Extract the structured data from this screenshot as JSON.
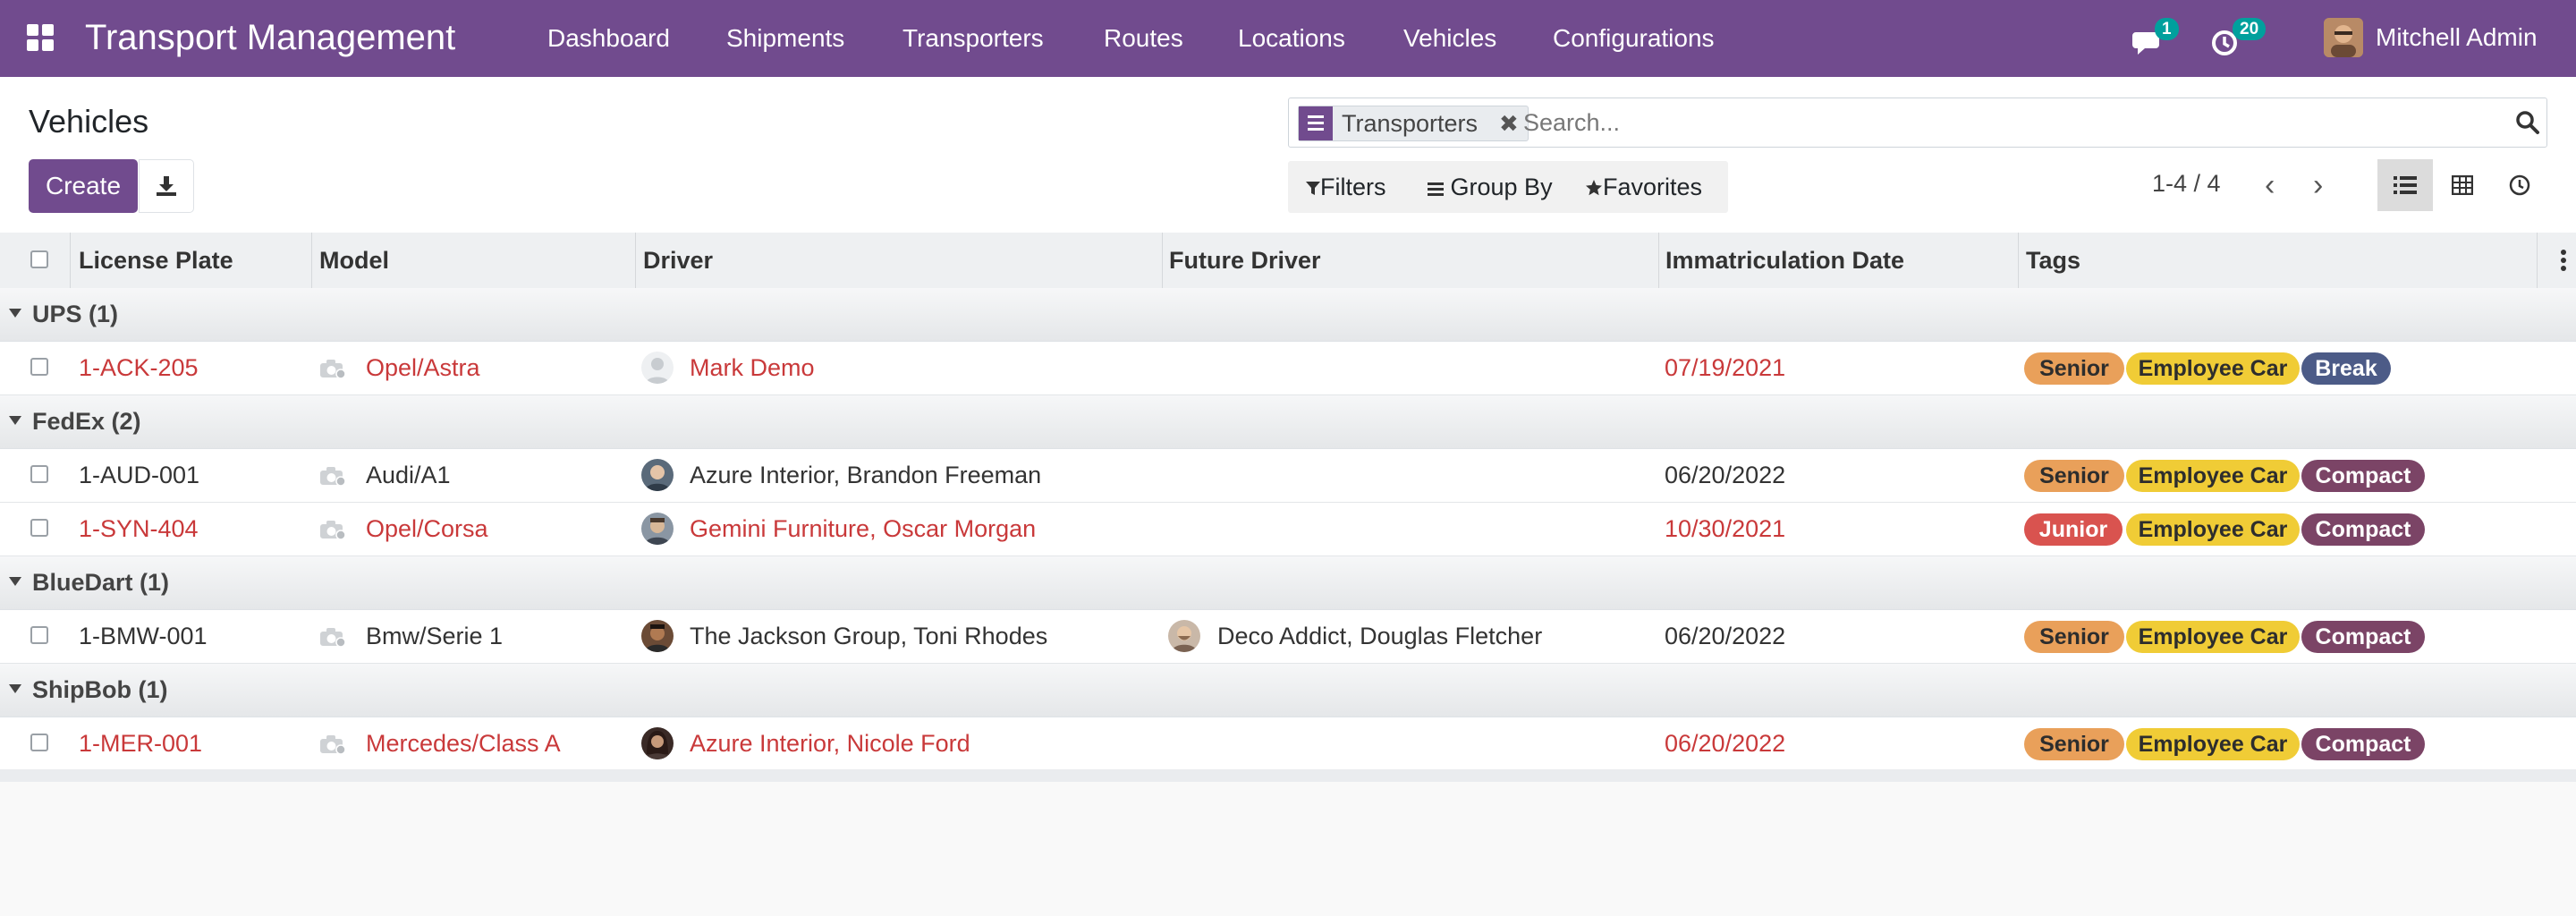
{
  "app": {
    "title": "Transport Management"
  },
  "nav": [
    "Dashboard",
    "Shipments",
    "Transporters",
    "Routes",
    "Locations",
    "Vehicles",
    "Configurations"
  ],
  "systray": {
    "messages_count": "1",
    "activities_count": "20",
    "user_name": "Mitchell Admin"
  },
  "control": {
    "title": "Vehicles",
    "create_label": "Create",
    "facet_label": "Transporters",
    "facet_close": "✖",
    "search_placeholder": "Search...",
    "filters_label": "Filters",
    "group_by_label": "Group By",
    "favorites_label": "Favorites",
    "pager": "1-4 / 4",
    "pager_prev": "‹",
    "pager_next": "›"
  },
  "columns": [
    "License Plate",
    "Model",
    "Driver",
    "Future Driver",
    "Immatriculation Date",
    "Tags"
  ],
  "groups": [
    {
      "label": "UPS (1)"
    },
    {
      "label": "FedEx (2)"
    },
    {
      "label": "BlueDart (1)"
    },
    {
      "label": "ShipBob (1)"
    }
  ],
  "rows": [
    {
      "plate": "1-ACK-205",
      "model": "Opel/Astra",
      "driver": "Mark Demo",
      "future_driver": "",
      "date": "07/19/2021",
      "tags": [
        "Senior",
        "Employee Car",
        "Break"
      ]
    },
    {
      "plate": "1-AUD-001",
      "model": "Audi/A1",
      "driver": "Azure Interior, Brandon Freeman",
      "future_driver": "",
      "date": "06/20/2022",
      "tags": [
        "Senior",
        "Employee Car",
        "Compact"
      ]
    },
    {
      "plate": "1-SYN-404",
      "model": "Opel/Corsa",
      "driver": "Gemini Furniture, Oscar Morgan",
      "future_driver": "",
      "date": "10/30/2021",
      "tags": [
        "Junior",
        "Employee Car",
        "Compact"
      ]
    },
    {
      "plate": "1-BMW-001",
      "model": "Bmw/Serie 1",
      "driver": "The Jackson Group, Toni Rhodes",
      "future_driver": "Deco Addict, Douglas Fletcher",
      "date": "06/20/2022",
      "tags": [
        "Senior",
        "Employee Car",
        "Compact"
      ]
    },
    {
      "plate": "1-MER-001",
      "model": "Mercedes/Class A",
      "driver": "Azure Interior, Nicole Ford",
      "future_driver": "",
      "date": "06/20/2022",
      "tags": [
        "Senior",
        "Employee Car",
        "Compact"
      ]
    }
  ],
  "colors": {
    "brand": "#714b8e",
    "badge": "#00a09d",
    "overdue_text": "#c9393a",
    "tag_senior": "#e9a05a",
    "tag_junior": "#d9534f",
    "tag_employee_car": "#f0cc36",
    "tag_break": "#4c5b87",
    "tag_compact": "#7b4466"
  },
  "icons": [
    "apps-grid-icon",
    "chat-icon",
    "clock-icon",
    "download-icon",
    "funnel-icon",
    "bars-icon",
    "star-icon",
    "search-icon",
    "list-view-icon",
    "grid-view-icon",
    "activity-view-icon",
    "camera-icon",
    "kebab-icon"
  ]
}
